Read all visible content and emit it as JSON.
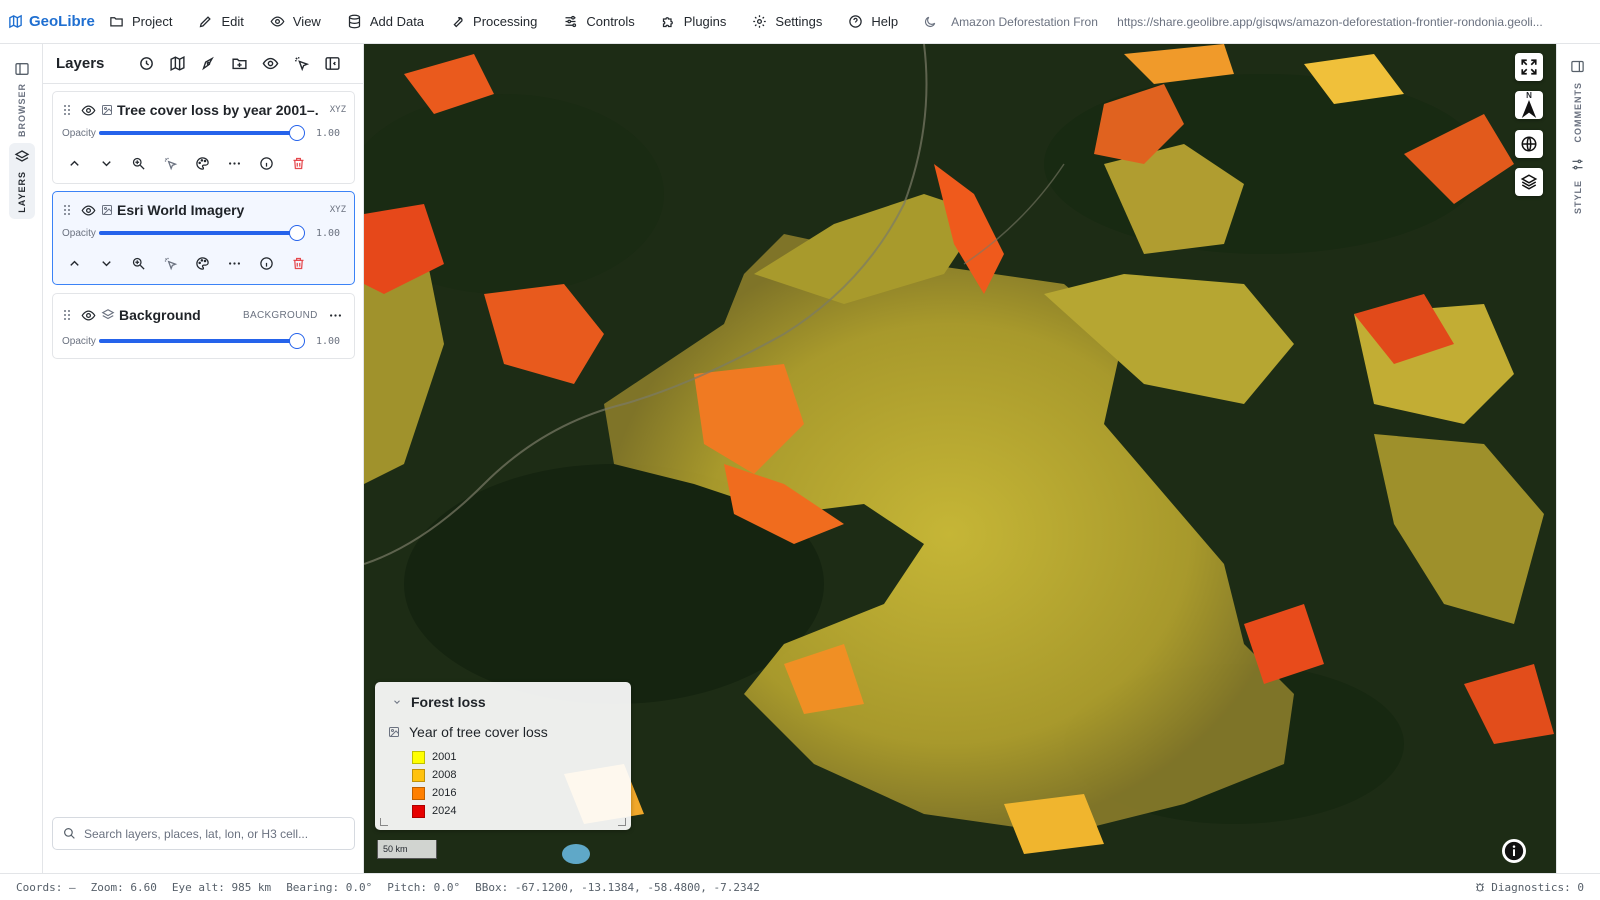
{
  "app": {
    "name": "GeoLibre"
  },
  "menu": [
    {
      "label": "Project",
      "icon": "folder-icon"
    },
    {
      "label": "Edit",
      "icon": "pencil-icon"
    },
    {
      "label": "View",
      "icon": "eye-icon"
    },
    {
      "label": "Add Data",
      "icon": "database-icon"
    },
    {
      "label": "Processing",
      "icon": "wrench-icon"
    },
    {
      "label": "Controls",
      "icon": "sliders-icon"
    },
    {
      "label": "Plugins",
      "icon": "puzzle-icon"
    },
    {
      "label": "Settings",
      "icon": "gear-icon"
    },
    {
      "label": "Help",
      "icon": "help-icon"
    }
  ],
  "header": {
    "project_title": "Amazon Deforestation Fron",
    "share_url": "https://share.geolibre.app/gisqws/amazon-deforestation-frontier-rondonia.geoli..."
  },
  "left_rail": {
    "browser": "BROWSER",
    "layers": "LAYERS"
  },
  "right_rail": {
    "comments": "COMMENTS",
    "style": "STYLE"
  },
  "layers_panel": {
    "title": "Layers",
    "opacity_label": "Opacity",
    "layers": [
      {
        "name": "Tree cover loss by year 2001–...",
        "kind": "XYZ",
        "opacity": 1.0,
        "opacity_text": "1.00",
        "selected": false
      },
      {
        "name": "Esri World Imagery",
        "kind": "XYZ",
        "opacity": 1.0,
        "opacity_text": "1.00",
        "selected": true
      },
      {
        "name": "Background",
        "kind": "BACKGROUND",
        "opacity": 1.0,
        "opacity_text": "1.00",
        "selected": false
      }
    ],
    "search_placeholder": "Search layers, places, lat, lon, or H3 cell..."
  },
  "legend": {
    "title": "Forest loss",
    "layer_name": "Year of tree cover loss",
    "items": [
      {
        "label": "2001",
        "color": "#ffff00"
      },
      {
        "label": "2008",
        "color": "#ffc20e"
      },
      {
        "label": "2016",
        "color": "#ff7f00"
      },
      {
        "label": "2024",
        "color": "#e60000"
      }
    ]
  },
  "map": {
    "scale_label": "50 km",
    "north_label": "N"
  },
  "status": {
    "coords": "Coords: —",
    "zoom": "Zoom: 6.60",
    "eye_alt": "Eye alt: 985 km",
    "bearing": "Bearing: 0.0°",
    "pitch": "Pitch: 0.0°",
    "bbox": "BBox: -67.1200, -13.1384, -58.4800, -7.2342",
    "diagnostics": "Diagnostics: 0"
  },
  "colors": {
    "accent": "#2563eb",
    "brand": "#1f6fd1",
    "forest": "#1c2b14"
  }
}
